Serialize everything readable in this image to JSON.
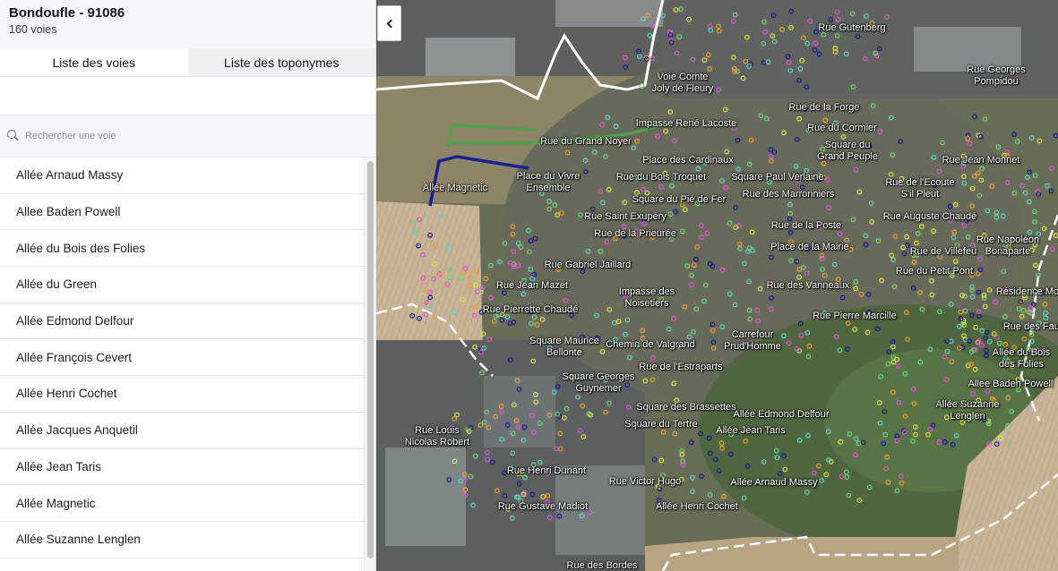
{
  "commune": {
    "title": "Bondoufle - 91086",
    "count": "160 voies"
  },
  "tabs": [
    {
      "label": "Liste des voies"
    },
    {
      "label": "Liste des toponymes"
    }
  ],
  "search": {
    "placeholder": "Rechercher une voie",
    "value": ""
  },
  "voies": [
    "Allée Arnaud Massy",
    "Allee Baden Powell",
    "Allée du Bois des Folies",
    "Allée du Green",
    "Allée Edmond Delfour",
    "Allée François Cevert",
    "Allée Henri Cochet",
    "Allée Jacques Anquetil",
    "Allée Jean Taris",
    "Allée Magnetic",
    "Allée Suzanne Lenglen"
  ],
  "map_labels": [
    {
      "text": "Rue Gutenberg"
    },
    {
      "text": "Rue Georges\nPompidou"
    },
    {
      "text": "Voie Comte\nJoly de Fleury"
    },
    {
      "text": "Rue de la Forge"
    },
    {
      "text": "Impasse René Lacoste"
    },
    {
      "text": "Rue du Cormier"
    },
    {
      "text": "Rue du Grand Noyer"
    },
    {
      "text": "Square du\nGrand Peuple"
    },
    {
      "text": "Place des Cardinaux"
    },
    {
      "text": "Rue Jean Monnet"
    },
    {
      "text": "Place du Vivre\nEnsemble"
    },
    {
      "text": "Rue du Bois Troquet"
    },
    {
      "text": "Square Paul Verlaine"
    },
    {
      "text": "Rue de l'Ecoute\nS'il Pleut"
    },
    {
      "text": "Allée Magnetic"
    },
    {
      "text": "Rue des Marronniers"
    },
    {
      "text": "Square du Pié de Fer"
    },
    {
      "text": "Rue Saint Exupéry"
    },
    {
      "text": "Rue Auguste Chaudé"
    },
    {
      "text": "Rue de la Poste"
    },
    {
      "text": "Rue de la Prieurée"
    },
    {
      "text": "Place de la Mairie"
    },
    {
      "text": "Rue de Villefeu"
    },
    {
      "text": "Rue Napoléon\nBonaparte"
    },
    {
      "text": "Rue Gabriel Jaillard"
    },
    {
      "text": "Rue du Petit Pont"
    },
    {
      "text": "Rue Jean Mazet"
    },
    {
      "text": "Rue des Vanneaux"
    },
    {
      "text": "Impasse des\nNoisetiers"
    },
    {
      "text": "Résidence Mondesir"
    },
    {
      "text": "Rue Pierrette Chaudé"
    },
    {
      "text": "Rue Pierre Marcille"
    },
    {
      "text": "Carrefour\nPrud'Homme"
    },
    {
      "text": "Rue des Fauvettes"
    },
    {
      "text": "Square Maurice\nBellonte"
    },
    {
      "text": "Chemin de Valgrand"
    },
    {
      "text": "Allée du Bois\ndes Folies"
    },
    {
      "text": "Rue de l'Estraparts"
    },
    {
      "text": "Square Georges\nGuynemer"
    },
    {
      "text": "Allee Baden Powell"
    },
    {
      "text": "Allée Suzanne\nLenglen"
    },
    {
      "text": "Square des Brassettes"
    },
    {
      "text": "Allée Edmond Delfour"
    },
    {
      "text": "Square du Tertre"
    },
    {
      "text": "Allée Jean Taris"
    },
    {
      "text": "Rue Louis\nNicolas Robert"
    },
    {
      "text": "Rue Henri Dunant"
    },
    {
      "text": "Rue Victor Hugo"
    },
    {
      "text": "Allée Arnaud Massy"
    },
    {
      "text": "Rue Gustave Madiot"
    },
    {
      "text": "Allée Henri Cochet"
    },
    {
      "text": "Rue des Bordes"
    }
  ],
  "colors": {
    "accent": "#000091",
    "dot_green": "#6fd87a",
    "dot_blue": "#16168f",
    "dot_teal": "#5fd8c4",
    "dot_pink": "#e055d4",
    "dot_yellow": "#e6e24a",
    "dot_orange": "#f0a030"
  }
}
